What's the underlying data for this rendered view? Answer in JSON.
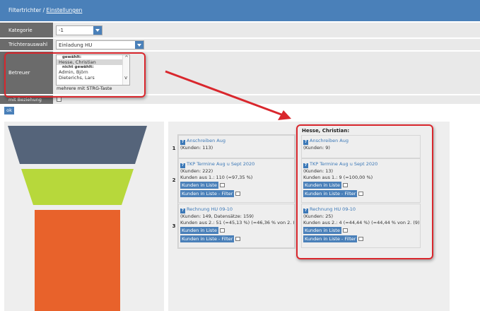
{
  "header": {
    "prefix": "Filtertrichter /",
    "link": "Einstellungen"
  },
  "filters": {
    "kategorie": {
      "label": "Kategorie",
      "value": "-1"
    },
    "trichter": {
      "label": "Trichterauswahl",
      "value": "Einladung HU"
    },
    "betreuer": {
      "label": "Betreuer",
      "group_selected": "gewählt:",
      "selected_options": [
        "Hesse, Christian"
      ],
      "group_unselected": "nicht gewählt:",
      "unselected_options": [
        "Admin, Björn",
        "Dieterichs, Lars"
      ],
      "hint": "mehrere mit STRG-Taste"
    },
    "beziehung": {
      "label": "mit Beziehung"
    },
    "ok_label": "ok"
  },
  "funnel": {
    "colors": [
      "#55647a",
      "#b7d83b",
      "#e8622b"
    ]
  },
  "table": {
    "column_header": "Hesse, Christian:",
    "rows": [
      {
        "num": "1",
        "left": {
          "title": "Anschreiben Aug",
          "lines": [
            "(Kunden: 113)"
          ],
          "buttons": []
        },
        "right": {
          "title": "Anschreiben Aug",
          "lines": [
            "(Kunden: 9)"
          ],
          "buttons": []
        }
      },
      {
        "num": "2",
        "left": {
          "title": "TKP Termine Aug u Sept 2020",
          "lines": [
            "(Kunden: 222)",
            "Kunden aus 1.: 110 (=97,35 %)"
          ],
          "buttons": [
            "Kunden in Liste",
            "Kunden in Liste - Filter"
          ]
        },
        "right": {
          "title": "TKP Termine Aug u Sept 2020",
          "lines": [
            "(Kunden: 13)",
            "Kunden aus 1.: 9 (=100,00 %)"
          ],
          "buttons": [
            "Kunden in Liste",
            "Kunden in Liste - Filter"
          ]
        }
      },
      {
        "num": "3",
        "left": {
          "title": "Rechnung HU 09-10",
          "lines": [
            "(Kunden: 149, Datensätze: 159)",
            "Kunden aus 2.: 51 (=45,13 %) (=46,36 % von 2. (110))"
          ],
          "buttons": [
            "Kunden in Liste",
            "Kunden in Liste - Filter"
          ]
        },
        "right": {
          "title": "Rechnung HU 09-10",
          "lines": [
            "(Kunden: 25)",
            "Kunden aus 2.: 4 (=44,44 %) (=44,44 % von 2. (9))"
          ],
          "buttons": [
            "Kunden in Liste",
            "Kunden in Liste - Filter"
          ]
        }
      }
    ]
  },
  "colors": {
    "accent": "#4a80b9",
    "label_bg": "#6b6b6b",
    "highlight": "#d9272d"
  }
}
